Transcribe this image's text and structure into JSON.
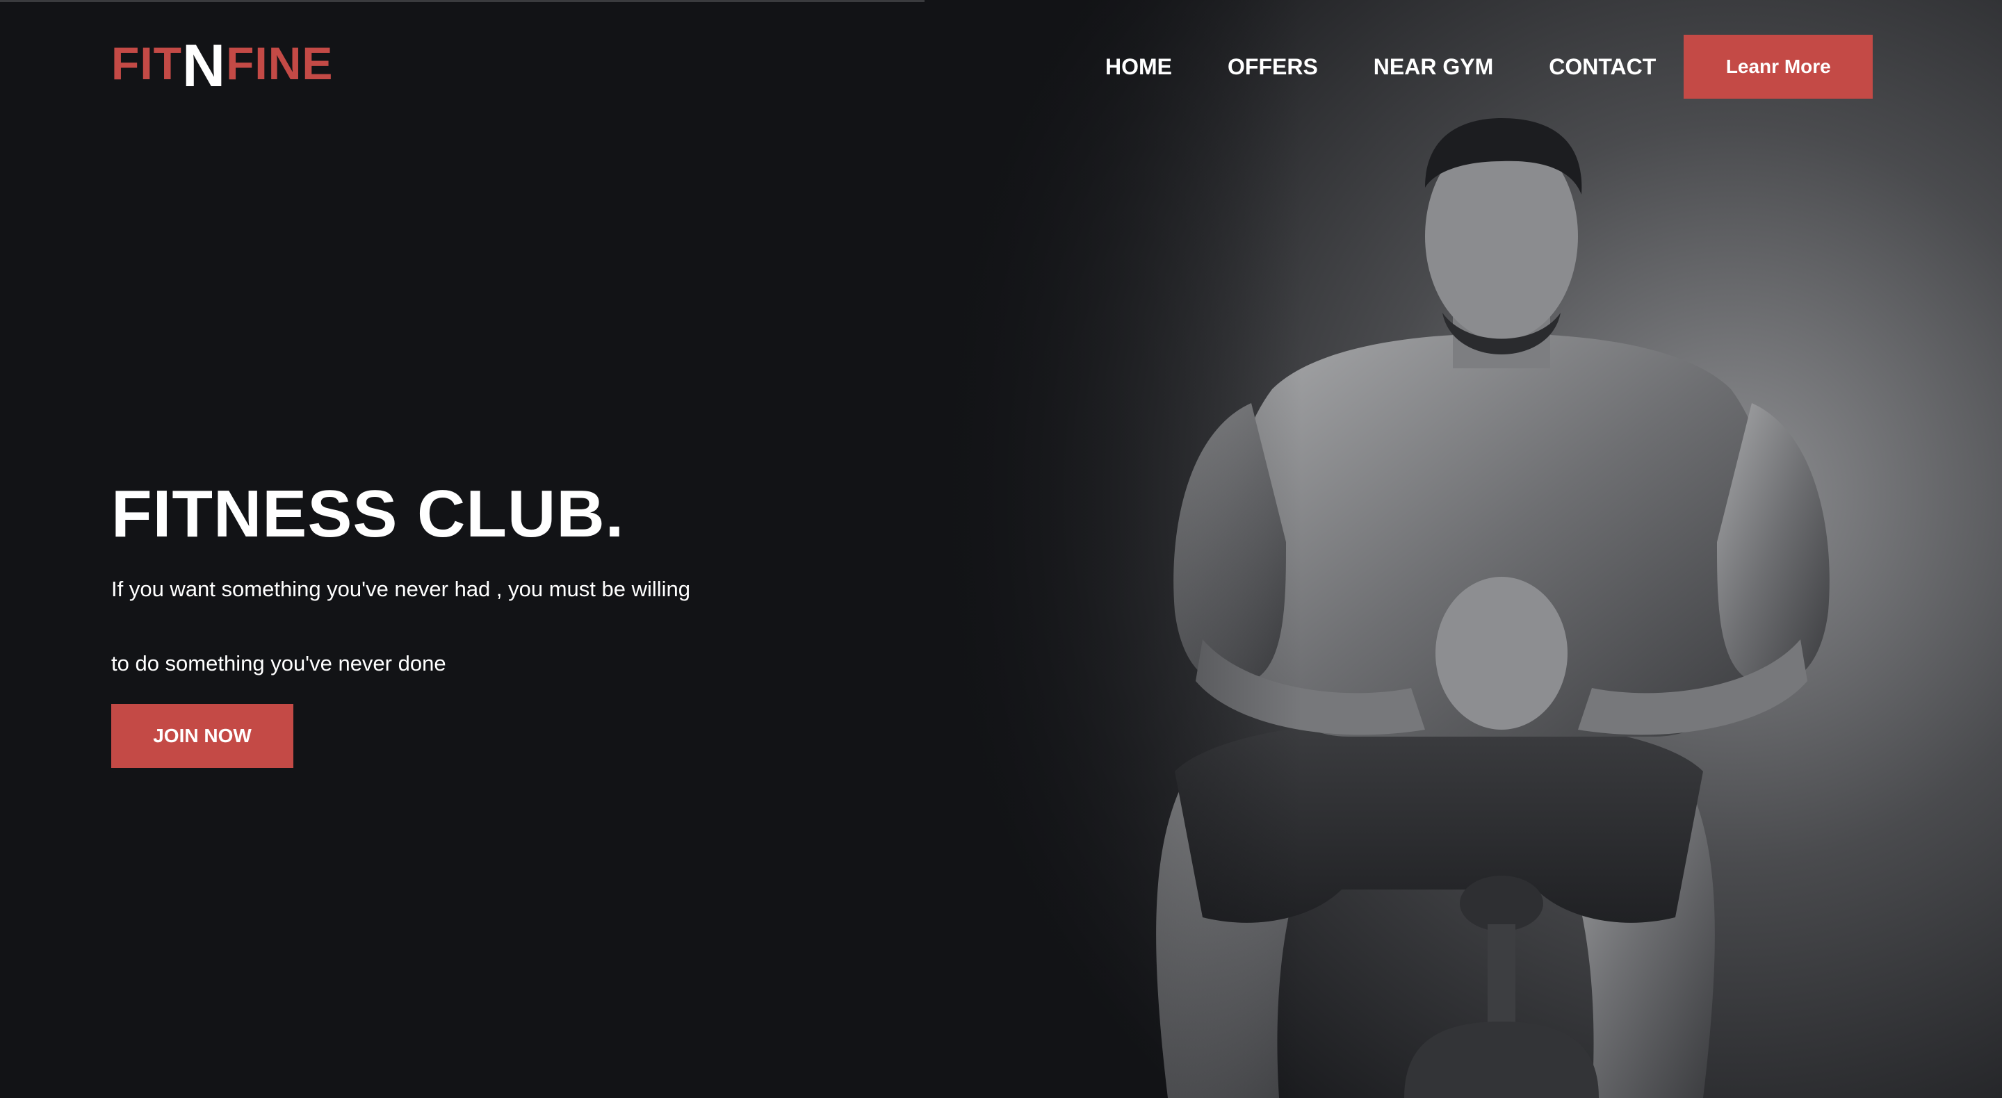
{
  "brand": {
    "logo_part1": "FIT",
    "logo_part2": "N",
    "logo_part3": "FINE",
    "accent_color": "#c44a46",
    "background_color": "#121316"
  },
  "nav": {
    "items": [
      {
        "label": "HOME"
      },
      {
        "label": "OFFERS"
      },
      {
        "label": "NEAR GYM"
      },
      {
        "label": "CONTACT"
      }
    ],
    "cta_label": "Leanr More"
  },
  "hero": {
    "title": "FITNESS CLUB.",
    "tagline_line1": "If you want something you've never had , you must be willing",
    "tagline_line2": "to do something you've never done",
    "cta_label": "JOIN NOW",
    "image": "muscular-man-seated-on-exercise-bike-photo"
  }
}
